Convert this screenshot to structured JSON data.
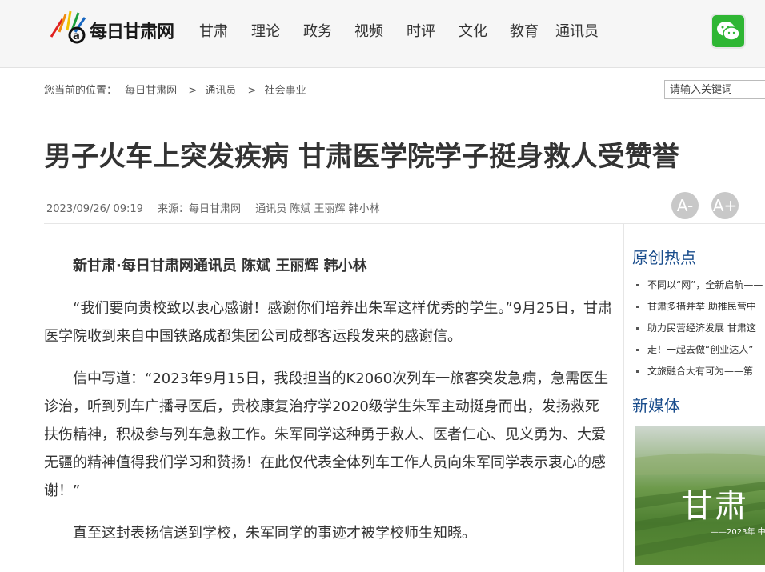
{
  "header": {
    "site_name": "每日甘肃网",
    "nav": [
      "甘肃",
      "理论",
      "政务",
      "视频",
      "时评",
      "文化",
      "教育",
      "通讯员"
    ],
    "wechat_icon": "wechat-icon"
  },
  "breadcrumb": {
    "prefix": "您当前的位置：",
    "items": [
      "每日甘肃网",
      "通讯员",
      "社会事业"
    ],
    "separator": ">"
  },
  "search": {
    "placeholder": "请输入关键词"
  },
  "article": {
    "title": "男子火车上突发疾病 甘肃医学院学子挺身救人受赞誉",
    "date": "2023/09/26/ 09:19",
    "source": "来源：每日甘肃网",
    "authors": "通讯员 陈斌 王丽辉 韩小林",
    "font_decrease": "A-",
    "font_increase": "A+",
    "paragraphs": [
      "新甘肃·每日甘肃网通讯员 陈斌 王丽辉 韩小林",
      "“我们要向贵校致以衷心感谢！感谢你们培养出朱军这样优秀的学生。”9月25日，甘肃医学院收到来自中国铁路成都集团公司成都客运段发来的感谢信。",
      "信中写道：“2023年9月15日，我段担当的K2060次列车一旅客突发急病，急需医生诊治，听到列车广播寻医后，贵校康复治疗学2020级学生朱军主动挺身而出，发扬救死扶伤精神，积极参与列车急救工作。朱军同学这种勇于救人、医者仁心、见义勇为、大爱无疆的精神值得我们学习和赞扬！在此仅代表全体列车工作人员向朱军同学表示衷心的感谢！”",
      "直至这封表扬信送到学校，朱军同学的事迹才被学校师生知晓。"
    ]
  },
  "sidebar": {
    "hot_heading": "原创热点",
    "hot_items": [
      "不同以“网”，全新启航——",
      "甘肃多措并举 助推民营中",
      "助力民营经济发展 甘肃这",
      "走！一起去做“创业达人”",
      "文旅融合大有可为——第"
    ],
    "media_heading": "新媒体",
    "media_caption": "甘肃",
    "media_sub": "——2023年 中"
  },
  "colors": {
    "accent_blue": "#1a4d8c",
    "wechat_green": "#2fb634"
  }
}
